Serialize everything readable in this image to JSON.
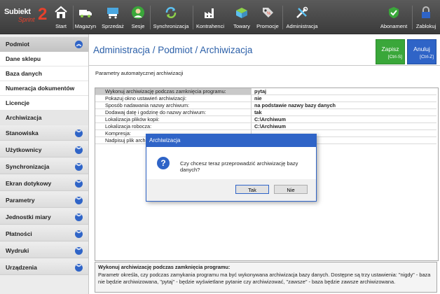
{
  "app": {
    "logo_main": "Subiekt",
    "logo_sub": "Sprint",
    "logo_num": "2"
  },
  "toolbar": {
    "items": [
      {
        "label": "Start",
        "icon": "house-icon"
      },
      {
        "label": "Magazyn",
        "icon": "truck-icon"
      },
      {
        "label": "Sprzedaż",
        "icon": "cart-icon"
      },
      {
        "label": "Sesje",
        "icon": "user-icon"
      },
      {
        "label": "Synchronizacja",
        "icon": "sync-icon"
      },
      {
        "label": "Kontrahenci",
        "icon": "factory-icon"
      },
      {
        "label": "Towary",
        "icon": "box-icon"
      },
      {
        "label": "Promocje",
        "icon": "tag-icon"
      },
      {
        "label": "Administracja",
        "icon": "tools-icon"
      },
      {
        "label": "Abonament",
        "icon": "shield-icon"
      },
      {
        "label": "Zablokuj",
        "icon": "lock-icon"
      }
    ]
  },
  "sidebar": {
    "header": "Podmiot",
    "sub_items": [
      "Dane sklepu",
      "Baza danych",
      "Numeracja dokumentów",
      "Licencje",
      "Archiwizacja"
    ],
    "groups": [
      "Stanowiska",
      "Użytkownicy",
      "Synchronizacja",
      "Ekran dotykowy",
      "Parametry",
      "Jednostki miary",
      "Płatności",
      "Wydruki",
      "Urządzenia"
    ]
  },
  "main": {
    "title": "Administracja / Podmiot / Archiwizacja",
    "save_label": "Zapisz",
    "save_shortcut": "[Ctrl-S]",
    "cancel_label": "Anuluj",
    "cancel_shortcut": "[Ctrl-Z]",
    "section_label": "Parametry automatycznej archiwizacji",
    "rows": [
      {
        "key": "Wykonuj archiwizację podczas zamknięcia programu:",
        "value": "pytaj"
      },
      {
        "key": "Pokazuj okno ustawień archiwizacji:",
        "value": "nie"
      },
      {
        "key": "Sposób nadawania nazwy archiwum:",
        "value": "na podstawie nazwy bazy danych"
      },
      {
        "key": "Dodawaj datę i godzinę do nazwy archiwum:",
        "value": "tak"
      },
      {
        "key": "Lokalizacja plików kopii:",
        "value": "C:\\Archiwum"
      },
      {
        "key": "Lokalizacja robocza:",
        "value": "C:\\Archiwum"
      },
      {
        "key": "Kompresja:",
        "value": ""
      },
      {
        "key": "Nadpisuj plik archiwum:",
        "value": ""
      }
    ],
    "desc_title": "Wykonuj archiwizację podczas zamknięcia programu:",
    "desc_text": "Parametr określa, czy podczas zamykania programu ma być wykonywana archiwizacja bazy danych. Dostępne są trzy ustawienia: \"nigdy\" - baza nie będzie archiwizowana, \"pytaj\" - będzie wyświetlane pytanie czy archiwizować, \"zawsze\" - baza będzie zawsze archiwizowana."
  },
  "dialog": {
    "title": "Archiwizacja",
    "icon": "question-icon",
    "message": "Czy chcesz teraz przeprowadzić archiwizację bazy danych?",
    "yes_label": "Tak",
    "no_label": "Nie"
  },
  "colors": {
    "accent": "#2f64c7",
    "save_green": "#3aa73a",
    "toolbar_bg": "#474747",
    "title_blue": "#2b5fa8"
  }
}
